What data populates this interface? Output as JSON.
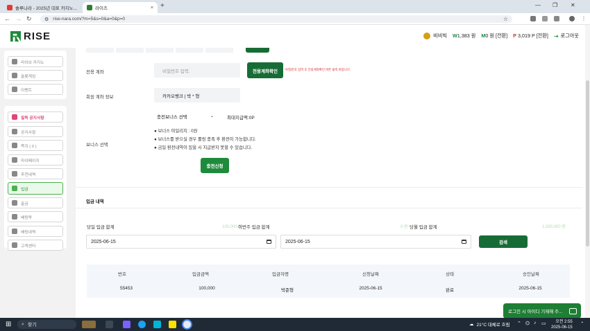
{
  "browser": {
    "tabs": [
      {
        "label": "솔루나라 - 2025년 대표 카지노...",
        "active": false
      },
      {
        "label": "라이즈",
        "active": true
      }
    ],
    "url": "rise-nara.com/?m=5&s=0&a=0&p=0"
  },
  "header": {
    "logo": "RISE",
    "username": "비비빅",
    "won_prefix": "W",
    "balance": "1,383 원",
    "m_prefix": "M",
    "mileage": "0 원 [전환]",
    "p_prefix": "P",
    "points": "3,019 P [전환]",
    "logout": "로그아웃"
  },
  "sidebar": {
    "group1": [
      {
        "label": "라이브 카지노",
        "icon": "cards-icon"
      },
      {
        "label": "슬롯게임",
        "icon": "slot-icon"
      },
      {
        "label": "이벤트",
        "icon": "event-icon"
      }
    ],
    "group2": [
      {
        "label": "필독 공지사항",
        "icon": "notice-icon",
        "hot": true
      },
      {
        "label": "공지사항",
        "icon": "info-icon"
      },
      {
        "label": "쪽지 ( 0 )",
        "icon": "message-icon"
      },
      {
        "label": "마이페이지",
        "icon": "user-icon"
      },
      {
        "label": "추천내역",
        "icon": "recommend-icon"
      },
      {
        "label": "입금",
        "icon": "deposit-icon",
        "active": true
      },
      {
        "label": "출금",
        "icon": "withdraw-icon"
      },
      {
        "label": "베팅락",
        "icon": "lock-icon"
      },
      {
        "label": "배팅내역",
        "icon": "history-icon"
      },
      {
        "label": "고객센터",
        "icon": "support-icon"
      }
    ]
  },
  "form": {
    "account_label": "전용 계좌",
    "password_placeholder": "비밀번호 입력.",
    "account_button": "전용계좌확인",
    "account_note": "*비밀번호 입력 후 전용계좌확인 버튼 클릭 바랍니다.",
    "member_account_label": "회원 계좌 정보",
    "member_account_value": "카카오뱅크 | 박 * 형",
    "bonus_label": "보너스 선택",
    "bonus_select": "충전보너스 선택",
    "max_label": "최대지급액:0P",
    "bullets": [
      "보너스 마일리지 : 0원",
      "보너스를 받으실 경우 롤링 충족 후 환전이 가능합니다.",
      "금일 환전내역이 있을 시 지급받지 못할 수 있습니다."
    ],
    "submit_button": "충전신청"
  },
  "history": {
    "title": "입금 내역",
    "today_label": "당일 입금 합계",
    "today_value": "100,000 원",
    "week_label": "이번주 입금 합계",
    "week_value": "0 원",
    "month_label": "당월 입금 합계",
    "month_value": "1,000,000 원",
    "date_from": "2025-06-15",
    "date_to": "2025-06-15",
    "search_button": "검색",
    "columns": [
      "번호",
      "입금금액",
      "입금자명",
      "신청날짜",
      "상태",
      "승인날짜"
    ],
    "rows": [
      [
        "55453",
        "100,000",
        "박준형",
        "2025-06-15",
        "완료",
        "2025-06-15"
      ]
    ]
  },
  "chat": {
    "label": "로그인 시 아이디 기재해 주..."
  },
  "taskbar": {
    "search": "찾기",
    "weather": "21°C 대체로 흐림",
    "time": "오전 2:55",
    "date": "2025-06-15"
  }
}
